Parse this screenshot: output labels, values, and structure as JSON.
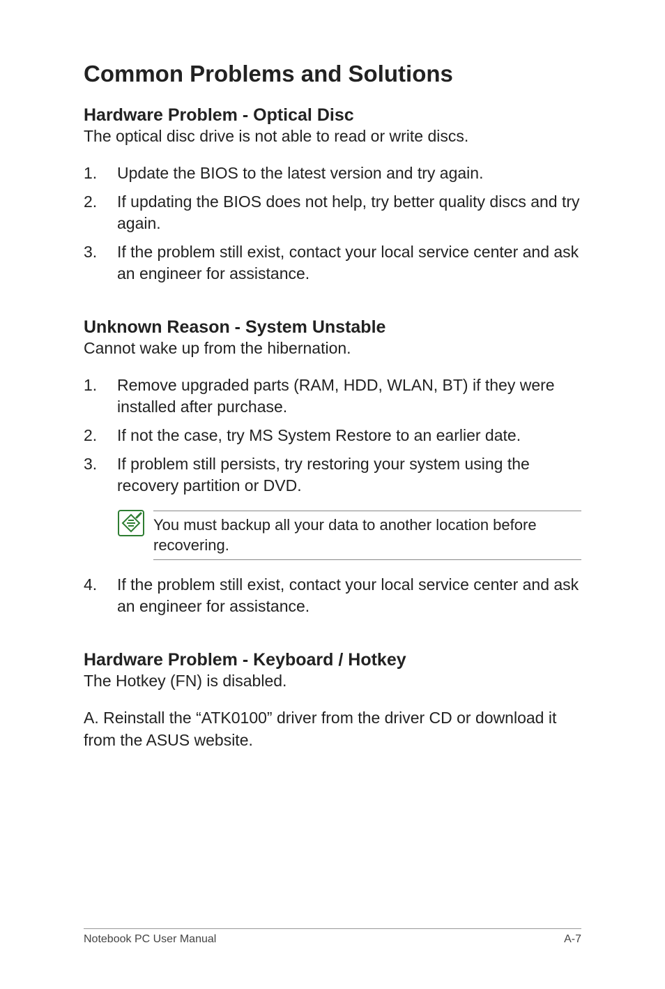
{
  "title": "Common Problems and Solutions",
  "sections": [
    {
      "heading": "Hardware Problem - Optical Disc",
      "intro": "The optical disc drive is not able to read or write discs.",
      "items": [
        "Update the BIOS to the latest version and try again.",
        "If updating the BIOS does not help, try better quality discs and try again.",
        "If the problem still exist, contact your local service center and ask an engineer for assistance."
      ]
    },
    {
      "heading": "Unknown Reason - System Unstable",
      "intro": "Cannot wake up from the hibernation.",
      "items": [
        "Remove upgraded parts (RAM, HDD, WLAN, BT) if they were installed after purchase.",
        "If not the case, try MS System Restore to an earlier date.",
        "If problem still persists, try restoring your system using the recovery partition or DVD."
      ],
      "note": "You must backup all your data to another location before recovering.",
      "after_items": [
        "If the problem still exist, contact your local service center and ask an engineer for assistance."
      ],
      "after_start": 4
    },
    {
      "heading": "Hardware Problem - Keyboard / Hotkey",
      "intro": "The Hotkey (FN) is disabled.",
      "body": "A. Reinstall the “ATK0100” driver from the driver CD or download it from the ASUS website."
    }
  ],
  "footer": {
    "left": "Notebook PC User Manual",
    "right": "A-7"
  },
  "icon_name": "note-icon"
}
